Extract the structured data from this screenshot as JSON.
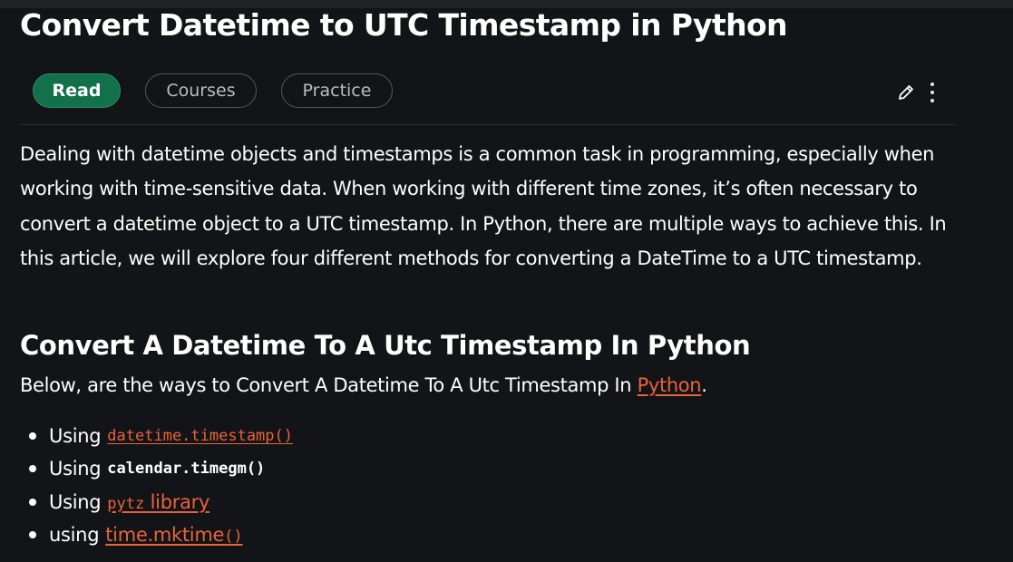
{
  "article": {
    "title": "Convert Datetime to UTC Timestamp in Python",
    "tabs": [
      {
        "label": "Read",
        "active": true
      },
      {
        "label": "Courses",
        "active": false
      },
      {
        "label": "Practice",
        "active": false
      }
    ],
    "tools": {
      "edit_icon": "pencil-icon",
      "more_icon": "kebab-menu-icon"
    },
    "intro": "Dealing with datetime objects and timestamps is a common task in programming, especially when working with time-sensitive data. When working with different time zones, it’s often necessary to convert a datetime object to a UTC timestamp. In Python, there are multiple ways to achieve this. In this article, we will explore four different methods for converting a DateTime to a UTC timestamp.",
    "section": {
      "heading": "Convert A Datetime To A Utc Timestamp In Python",
      "lead_text": "Below, are the ways to Convert A Datetime To A Utc Timestamp In",
      "lead_link": "Python",
      "lead_end": "."
    },
    "methods": [
      {
        "prefix": "Using",
        "text": "datetime.timestamp()",
        "link": true,
        "code": true
      },
      {
        "prefix": "Using",
        "text": "calendar.timegm()",
        "link": false,
        "code": true
      },
      {
        "prefix": "Using",
        "code_part": "pytz",
        "text_part": "library",
        "link": true
      },
      {
        "prefix": "using",
        "text_part": "time.mktime",
        "code_part": "()",
        "link": true
      }
    ]
  },
  "colors": {
    "background": "#131417",
    "accent_green": "#12704b",
    "link": "#e8643a"
  }
}
